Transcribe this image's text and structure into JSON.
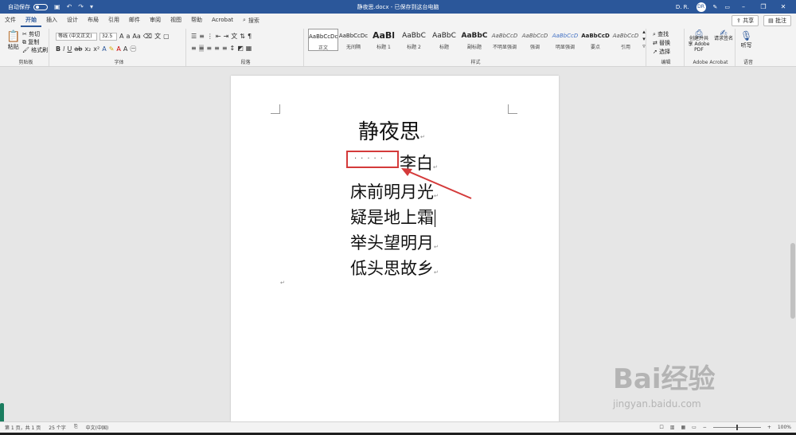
{
  "titlebar": {
    "autosave_label": "自动保存",
    "autosave_state": "关",
    "doc_title": "静夜思.docx - 已保存到这台电脑",
    "user": "D. R.",
    "avatar_text": "DR"
  },
  "menu": {
    "tabs": [
      "文件",
      "开始",
      "插入",
      "设计",
      "布局",
      "引用",
      "邮件",
      "审阅",
      "视图",
      "帮助",
      "Acrobat"
    ],
    "active_index": 1,
    "search_label": "搜索",
    "share_label": "共享",
    "comment_label": "批注"
  },
  "ribbon": {
    "clipboard": {
      "label": "剪贴板",
      "paste": "粘贴",
      "cut": "剪切",
      "copy": "复制",
      "format_painter": "格式刷"
    },
    "font": {
      "label": "字体",
      "font_name": "等线 (中文正文)",
      "font_size": "32.5"
    },
    "paragraph": {
      "label": "段落"
    },
    "styles": {
      "label": "样式",
      "items": [
        {
          "sample": "AaBbCcDc",
          "name": "正文"
        },
        {
          "sample": "AaBbCcDc",
          "name": "无间隔"
        },
        {
          "sample": "AaBl",
          "name": "标题 1"
        },
        {
          "sample": "AaBbC",
          "name": "标题 2"
        },
        {
          "sample": "AaBbC",
          "name": "标题"
        },
        {
          "sample": "AaBbC",
          "name": "副标题"
        },
        {
          "sample": "AaBbCcD",
          "name": "不明显强调"
        },
        {
          "sample": "AaBbCcD",
          "name": "强调"
        },
        {
          "sample": "AaBbCcD",
          "name": "明显强调"
        },
        {
          "sample": "AaBbCcD",
          "name": "要点"
        },
        {
          "sample": "AaBbCcD",
          "name": "引用"
        }
      ]
    },
    "editing": {
      "label": "编辑",
      "find": "查找",
      "replace": "替换",
      "select": "选择"
    },
    "acrobat": {
      "label": "Adobe Acrobat",
      "create_share": "创建并共享 Adobe PDF",
      "request_sign": "请求签名"
    },
    "voice": {
      "label": "语音",
      "dictate": "听写"
    }
  },
  "document": {
    "title": "静夜思",
    "author_prefix": "·····",
    "author": "李白",
    "lines": [
      "床前明月光",
      "疑是地上霜",
      "举头望明月",
      "低头思故乡"
    ],
    "para_mark": "↵"
  },
  "status": {
    "page": "第 1 页，共 1 页",
    "words": "25 个字",
    "language": "中文(中国)",
    "zoom": "100%"
  },
  "watermark": {
    "brand": "Bai经验",
    "url": "jingyan.baidu.com"
  },
  "colors": {
    "accent": "#2b579a",
    "highlight_box": "#d43a3a"
  }
}
